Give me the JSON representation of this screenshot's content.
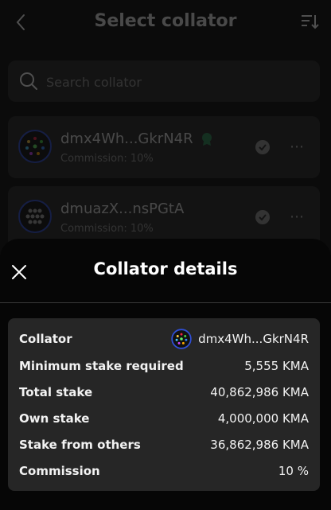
{
  "header": {
    "title": "Select collator"
  },
  "search": {
    "placeholder": "Search collator"
  },
  "collators": [
    {
      "name": "dmx4Wh...GkrN4R",
      "commission": "Commission: 10%"
    },
    {
      "name": "dmuazX...nsPGtA",
      "commission": "Commission: 10%"
    }
  ],
  "sheet": {
    "title": "Collator details",
    "rows": [
      {
        "label": "Collator",
        "value": "dmx4Wh...GkrN4R"
      },
      {
        "label": "Minimum stake required",
        "value": "5,555 KMA"
      },
      {
        "label": "Total stake",
        "value": "40,862,986 KMA"
      },
      {
        "label": "Own stake",
        "value": "4,000,000 KMA"
      },
      {
        "label": "Stake from others",
        "value": "36,862,986 KMA"
      },
      {
        "label": "Commission",
        "value": "10 %"
      }
    ]
  },
  "colors": {
    "background": "#0b0b0b",
    "card": "#2a2a2a",
    "sheet": "#060606",
    "avatar_ring": "#2f4fd6",
    "badge_green": "#2e8b57"
  },
  "icons": [
    "back-icon",
    "sort-icon",
    "search-icon",
    "verified-badge-icon",
    "check-icon",
    "more-icon",
    "close-icon",
    "avatar-icon"
  ]
}
